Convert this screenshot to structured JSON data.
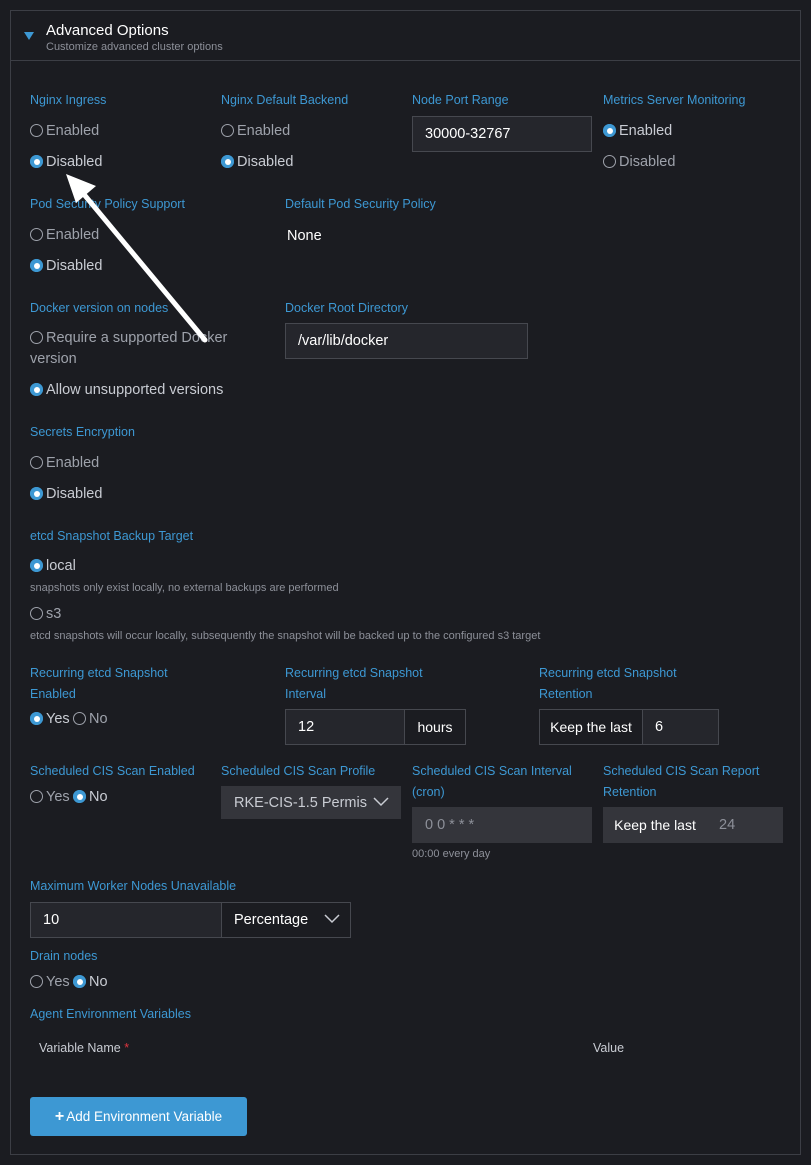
{
  "header": {
    "title": "Advanced Options",
    "subtitle": "Customize advanced cluster options"
  },
  "nginx_ingress": {
    "label": "Nginx Ingress",
    "options": [
      "Enabled",
      "Disabled"
    ],
    "selected": "Disabled"
  },
  "nginx_default_backend": {
    "label": "Nginx Default Backend",
    "options": [
      "Enabled",
      "Disabled"
    ],
    "selected": "Disabled"
  },
  "node_port_range": {
    "label": "Node Port Range",
    "value": "30000-32767"
  },
  "metrics_server": {
    "label": "Metrics Server Monitoring",
    "options": [
      "Enabled",
      "Disabled"
    ],
    "selected": "Enabled"
  },
  "psp_support": {
    "label": "Pod Security Policy Support",
    "options": [
      "Enabled",
      "Disabled"
    ],
    "selected": "Disabled"
  },
  "default_psp": {
    "label": "Default Pod Security Policy",
    "value": "None"
  },
  "docker_version": {
    "label": "Docker version on nodes",
    "option_required_line1": "Require a supported Docker",
    "option_required_line2": "version",
    "option_allow": "Allow unsupported versions",
    "selected": "Allow unsupported versions"
  },
  "docker_root": {
    "label": "Docker Root Directory",
    "value": "/var/lib/docker"
  },
  "secrets_encryption": {
    "label": "Secrets Encryption",
    "options": [
      "Enabled",
      "Disabled"
    ],
    "selected": "Disabled"
  },
  "etcd_backup": {
    "label": "etcd Snapshot Backup Target",
    "local_label": "local",
    "local_help": "snapshots only exist locally, no external backups are performed",
    "s3_label": "s3",
    "s3_help": "etcd snapshots will occur locally, subsequently the snapshot will be backed up to the configured s3 target",
    "selected": "local"
  },
  "recurring_enabled": {
    "label_line1": "Recurring etcd Snapshot",
    "label_line2": "Enabled",
    "options": [
      "Yes",
      "No"
    ],
    "selected": "Yes"
  },
  "recurring_interval": {
    "label_line1": "Recurring etcd Snapshot",
    "label_line2": "Interval",
    "value": "12",
    "unit": "hours"
  },
  "recurring_retention": {
    "label_line1": "Recurring etcd Snapshot",
    "label_line2": "Retention",
    "prefix": "Keep the last",
    "value": "6"
  },
  "cis_enabled": {
    "label": "Scheduled CIS Scan Enabled",
    "options": [
      "Yes",
      "No"
    ],
    "selected": "No"
  },
  "cis_profile": {
    "label": "Scheduled CIS Scan Profile",
    "value": "RKE-CIS-1.5 Permis"
  },
  "cis_interval": {
    "label_line1": "Scheduled CIS Scan Interval",
    "label_line2": "(cron)",
    "value": "0 0 * * *",
    "help": "00:00 every day"
  },
  "cis_retention": {
    "label_line1": "Scheduled CIS Scan Report",
    "label_line2": "Retention",
    "prefix": "Keep the last",
    "value": "24"
  },
  "max_unavailable": {
    "label": "Maximum Worker Nodes Unavailable",
    "value": "10",
    "unit": "Percentage"
  },
  "drain_nodes": {
    "label": "Drain nodes",
    "options": [
      "Yes",
      "No"
    ],
    "selected": "No"
  },
  "agent_env": {
    "label": "Agent Environment Variables",
    "col_name": "Variable Name",
    "required_mark": "*",
    "col_value": "Value",
    "add_button": "Add Environment Variable",
    "add_icon": "+"
  },
  "colors": {
    "accent": "#3d98d3",
    "background": "#1b1c21",
    "border": "#3c3e45"
  }
}
